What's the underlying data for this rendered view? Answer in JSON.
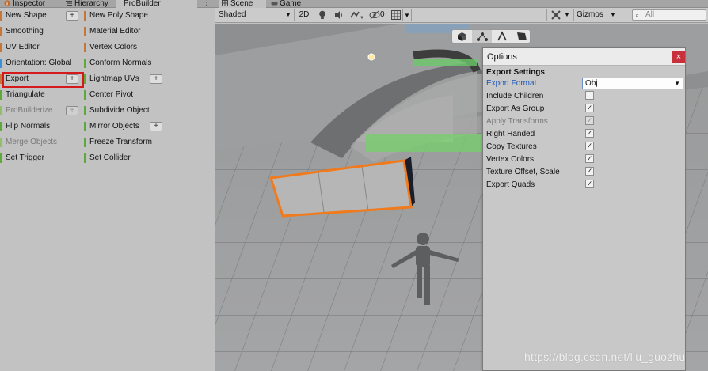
{
  "left_tabs": {
    "inspector": "Inspector",
    "hierarchy": "Hierarchy",
    "probuilder": "ProBuilder"
  },
  "probuilder": {
    "col1": [
      {
        "label": "New Shape",
        "color": "#c4773b",
        "plus": true,
        "enabled": true
      },
      {
        "label": "Smoothing",
        "color": "#c4773b",
        "plus": false,
        "enabled": true
      },
      {
        "label": "UV Editor",
        "color": "#c4773b",
        "plus": false,
        "enabled": true
      },
      {
        "label": "Orientation: Global",
        "color": "#3d8fd8",
        "plus": false,
        "enabled": true
      },
      {
        "label": "Export",
        "color": "#c4773b",
        "plus": true,
        "enabled": true
      },
      {
        "label": "Triangulate",
        "color": "#5fa83a",
        "plus": false,
        "enabled": true
      },
      {
        "label": "ProBuilderize",
        "color": "#8fbf6e",
        "plus": true,
        "enabled": false
      },
      {
        "label": "Flip Normals",
        "color": "#5fa83a",
        "plus": false,
        "enabled": true
      },
      {
        "label": "Merge Objects",
        "color": "#8fbf6e",
        "plus": false,
        "enabled": false
      },
      {
        "label": "Set Trigger",
        "color": "#5fa83a",
        "plus": false,
        "enabled": true
      }
    ],
    "col2": [
      {
        "label": "New Poly Shape",
        "color": "#c4773b",
        "plus": false,
        "enabled": true
      },
      {
        "label": "Material Editor",
        "color": "#c4773b",
        "plus": false,
        "enabled": true
      },
      {
        "label": "Vertex Colors",
        "color": "#c4773b",
        "plus": false,
        "enabled": true
      },
      {
        "label": "Conform Normals",
        "color": "#5fa83a",
        "plus": false,
        "enabled": true
      },
      {
        "label": "Lightmap UVs",
        "color": "#5fa83a",
        "plus": true,
        "enabled": true
      },
      {
        "label": "Center Pivot",
        "color": "#5fa83a",
        "plus": false,
        "enabled": true
      },
      {
        "label": "Subdivide Object",
        "color": "#5fa83a",
        "plus": false,
        "enabled": true
      },
      {
        "label": "Mirror Objects",
        "color": "#5fa83a",
        "plus": true,
        "enabled": true
      },
      {
        "label": "Freeze Transform",
        "color": "#5fa83a",
        "plus": false,
        "enabled": true
      },
      {
        "label": "Set Collider",
        "color": "#5fa83a",
        "plus": false,
        "enabled": true
      }
    ],
    "plus_glyph": "+"
  },
  "scene_tabs": {
    "scene": "Scene",
    "game": "Game"
  },
  "scene_toolbar": {
    "shading_mode": "Shaded",
    "mode_2d": "2D",
    "hidden_count": "0",
    "gizmos": "Gizmos",
    "search_placeholder": "All"
  },
  "options": {
    "title": "Options",
    "close_glyph": "×",
    "section": "Export Settings",
    "format_label": "Export Format",
    "format_value": "Obj",
    "rows": [
      {
        "label": "Include Children",
        "checked": false,
        "enabled": true
      },
      {
        "label": "Export As Group",
        "checked": true,
        "enabled": true
      },
      {
        "label": "Apply Transforms",
        "checked": true,
        "enabled": false
      },
      {
        "label": "Right Handed",
        "checked": true,
        "enabled": true
      },
      {
        "label": "Copy Textures",
        "checked": true,
        "enabled": true
      },
      {
        "label": "Vertex Colors",
        "checked": true,
        "enabled": true
      },
      {
        "label": "Texture Offset, Scale",
        "checked": true,
        "enabled": true
      },
      {
        "label": "Export Quads",
        "checked": true,
        "enabled": true
      }
    ]
  },
  "watermark": "https://blog.csdn.net/liu_guozhu",
  "colors": {
    "selection_outline": "#f07a1c",
    "highlight_box": "#d41a1a",
    "accent_link": "#1e55b8"
  }
}
